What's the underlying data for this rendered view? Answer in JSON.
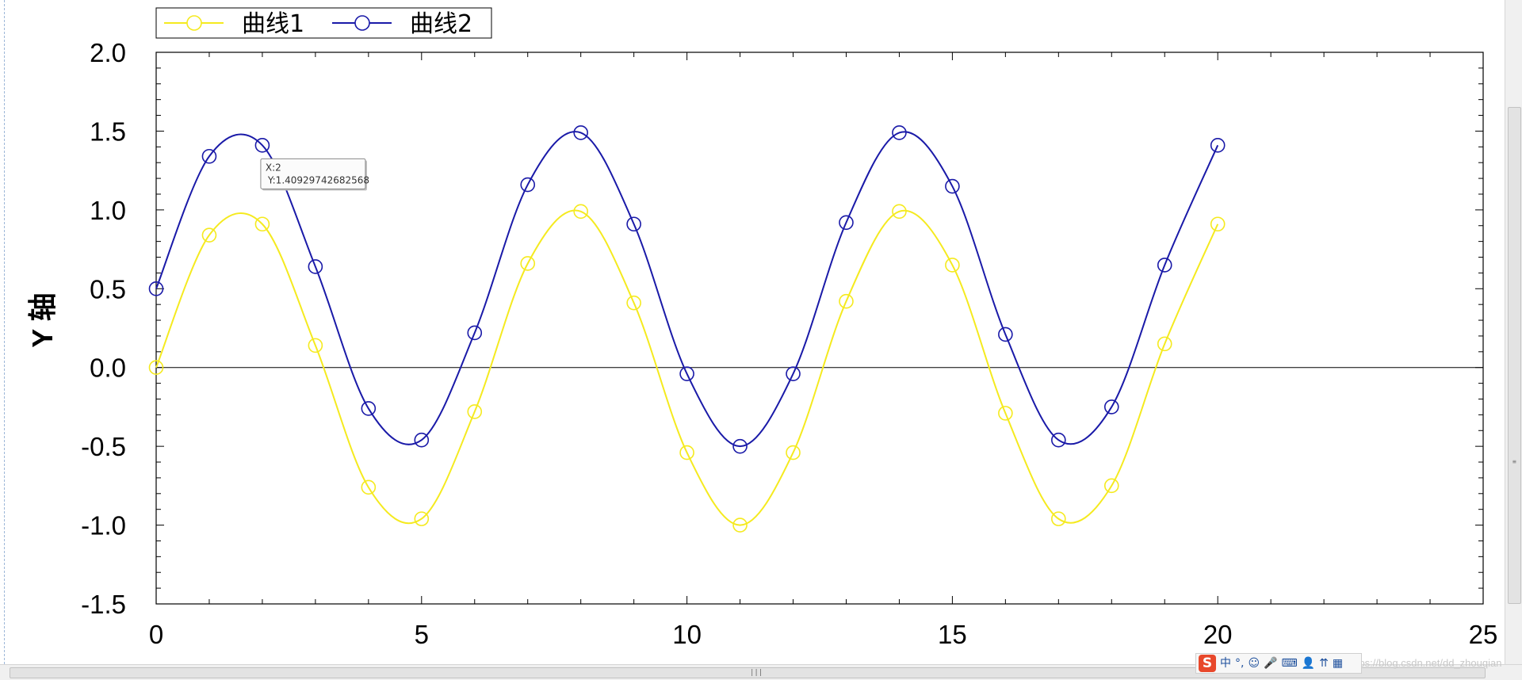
{
  "chart_data": {
    "type": "line",
    "title": "",
    "xlabel": "",
    "ylabel": "Y 轴",
    "xlim": [
      0,
      25
    ],
    "ylim": [
      -1.5,
      2.0
    ],
    "xticks": [
      0,
      5,
      10,
      15,
      20,
      25
    ],
    "yticks": [
      -1.5,
      -1.0,
      -0.5,
      0.0,
      0.5,
      1.0,
      1.5,
      2.0
    ],
    "xtick_labels": [
      "0",
      "5",
      "10",
      "15",
      "20",
      "25"
    ],
    "ytick_labels": [
      "-1.5",
      "-1.0",
      "-0.5",
      "0.0",
      "0.5",
      "1.0",
      "1.5",
      "2.0"
    ],
    "grid": false,
    "zero_line": true,
    "legend_position": "top-left",
    "x": [
      0,
      1,
      2,
      3,
      4,
      5,
      6,
      7,
      8,
      9,
      10,
      11,
      12,
      13,
      14,
      15,
      16,
      17,
      18,
      19,
      20
    ],
    "series": [
      {
        "name": "曲线1",
        "color": "#f5ea1f",
        "marker": "open-circle",
        "smooth": true,
        "values": [
          0.0,
          0.84,
          0.91,
          0.14,
          -0.76,
          -0.96,
          -0.28,
          0.66,
          0.99,
          0.41,
          -0.54,
          -1.0,
          -0.54,
          0.42,
          0.99,
          0.65,
          -0.29,
          -0.96,
          -0.75,
          0.15,
          0.91
        ]
      },
      {
        "name": "曲线2",
        "color": "#1a1aa8",
        "marker": "open-circle",
        "smooth": true,
        "values": [
          0.5,
          1.34,
          1.41,
          0.64,
          -0.26,
          -0.46,
          0.22,
          1.16,
          1.49,
          0.91,
          -0.04,
          -0.5,
          -0.04,
          0.92,
          1.49,
          1.15,
          0.21,
          -0.46,
          -0.25,
          0.65,
          1.41
        ]
      }
    ],
    "tooltip": {
      "x_text": "X:2",
      "y_text": "Y:1.40929742682568",
      "anchor_x": 2,
      "anchor_y": 1.41
    }
  },
  "ime": {
    "logo": "S",
    "items": [
      "中",
      "°,",
      "☺",
      "🎤",
      "⌨",
      "👤",
      "⇈",
      "▦"
    ]
  },
  "watermark": "https://blog.csdn.net/dd_zhouqian"
}
